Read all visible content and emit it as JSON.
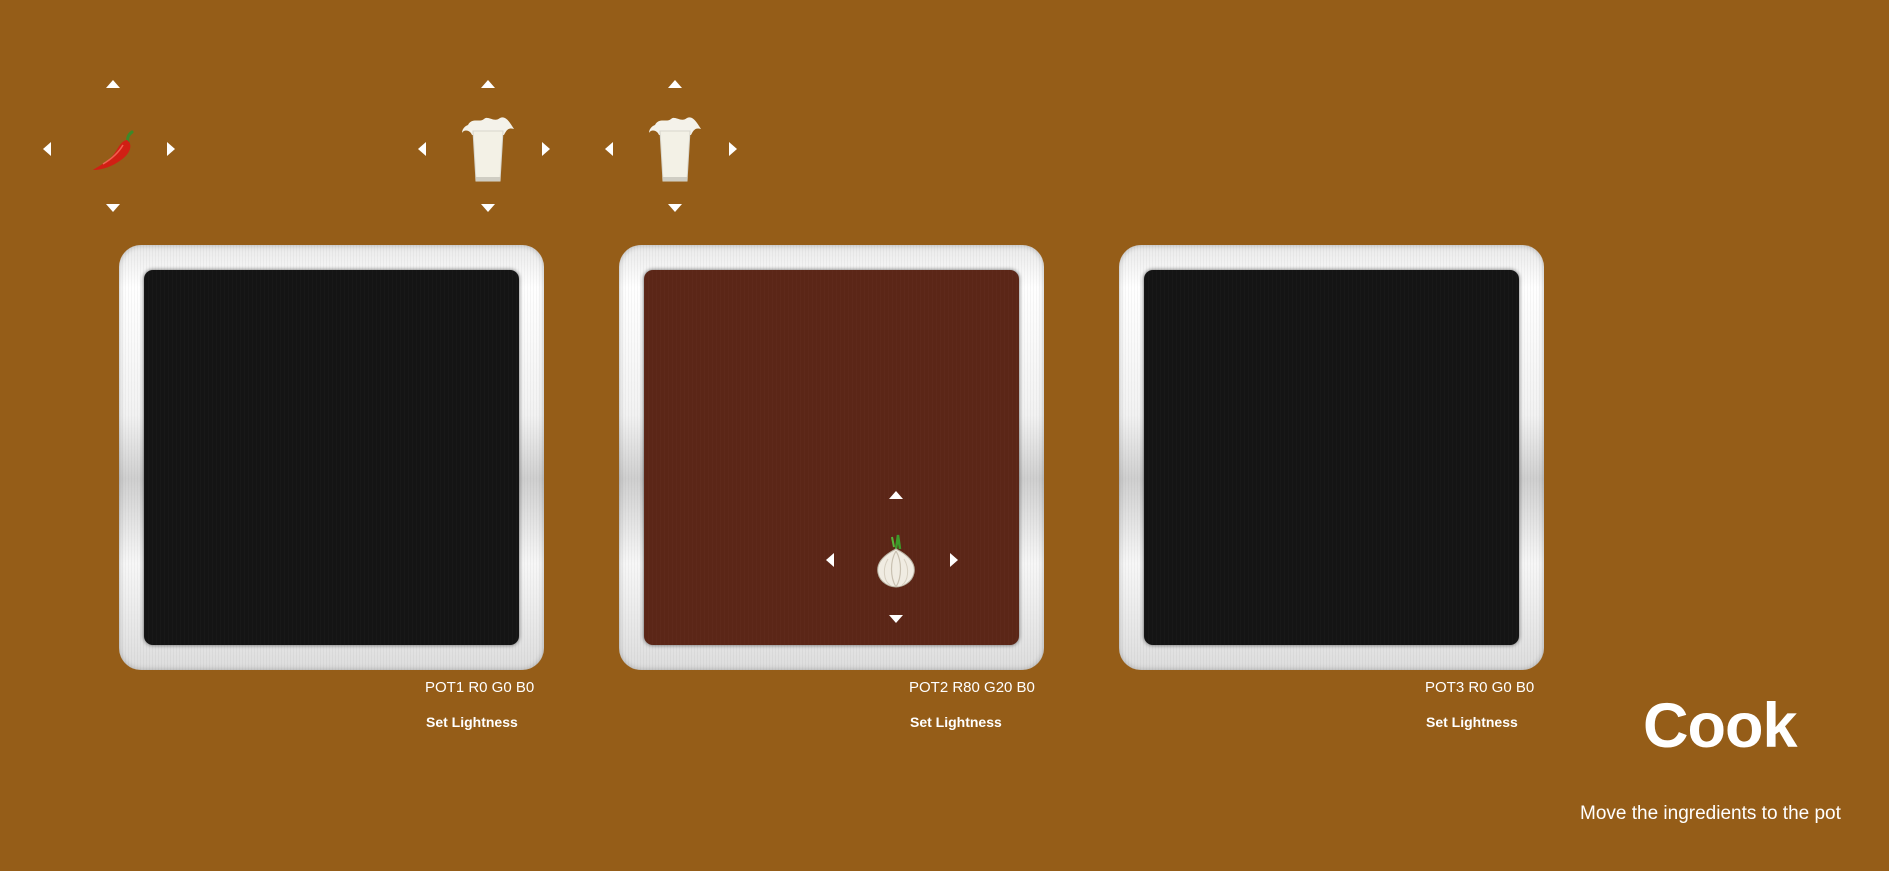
{
  "colors": {
    "background": "#955d18",
    "pot1_fill": "#141414",
    "pot2_fill": "#5b2617",
    "pot3_fill": "#141414"
  },
  "ingredients": [
    {
      "name": "chili-pepper",
      "icon": "chili-pepper-icon"
    },
    {
      "name": "milk",
      "icon": "milk-glass-icon"
    },
    {
      "name": "milk",
      "icon": "milk-glass-icon"
    },
    {
      "name": "garlic",
      "icon": "garlic-icon",
      "in_pot": "POT2"
    }
  ],
  "pots": [
    {
      "label": "POT1 R0 G0 B0",
      "button": "Set Lightness"
    },
    {
      "label": "POT2 R80 G20 B0",
      "button": "Set Lightness"
    },
    {
      "label": "POT3 R0 G0 B0",
      "button": "Set Lightness"
    }
  ],
  "cook_label": "Cook",
  "instruction": "Move the ingredients to the pot"
}
